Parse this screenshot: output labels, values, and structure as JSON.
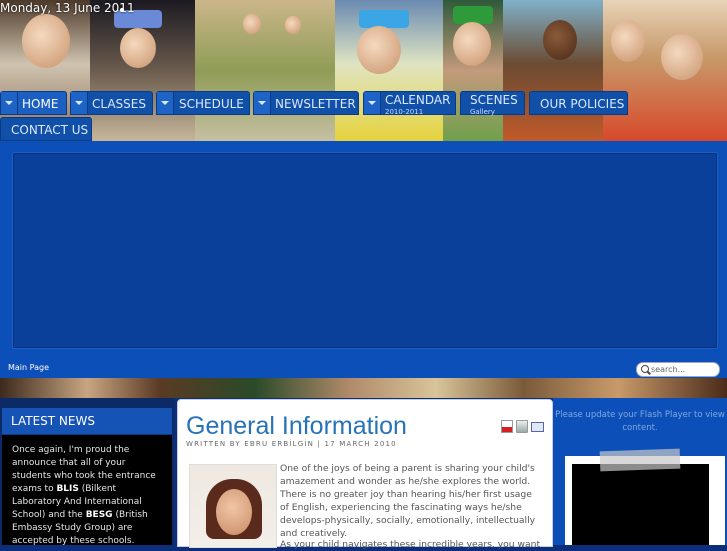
{
  "header": {
    "date": "Monday, 13 June 2011"
  },
  "nav": {
    "home": "HOME",
    "classes": "CLASSES",
    "schedule": "SCHEDULE",
    "newsletter": "NEWSLETTER",
    "calendar": "CALENDAR",
    "calendar_sub": "2010-2011",
    "scenes": "SCENES",
    "scenes_sub": "Gallery",
    "policies": "OUR POLICIES",
    "contact": "CONTACT US"
  },
  "main": {
    "breadcrumb": "Main Page",
    "search_placeholder": "search..."
  },
  "news": {
    "title": "LATEST NEWS",
    "t1": "Once again, I'm proud the announce that all of your students who took the entrance exams to ",
    "b1": "BLIS",
    "t2": " (Bilkent Laboratory And International School) and the ",
    "b2": "BESG",
    "t3": " (British Embassy Study Group) are accepted by these schools."
  },
  "article": {
    "title": "General Information",
    "meta": "WRITTEN BY EBRU ERBİLGİN | 17 MARCH 2010",
    "para1": "One of the joys of being a parent is sharing your child's amazement and wonder as he/she explores the world. There is no greater joy than hearing his/her first usage of English, experiencing the fascinating ways he/she develops-physically, socially, emotionally, intellectually and creatively.",
    "para2": "As your child navigates these incredible years, you want to be sure"
  },
  "sidebar": {
    "flash_message": "Please update your Flash Player to view content."
  },
  "colors": {
    "nav_blue": "#1150a8",
    "main_blue": "#0d4fb8",
    "title_blue": "#2873b8"
  }
}
